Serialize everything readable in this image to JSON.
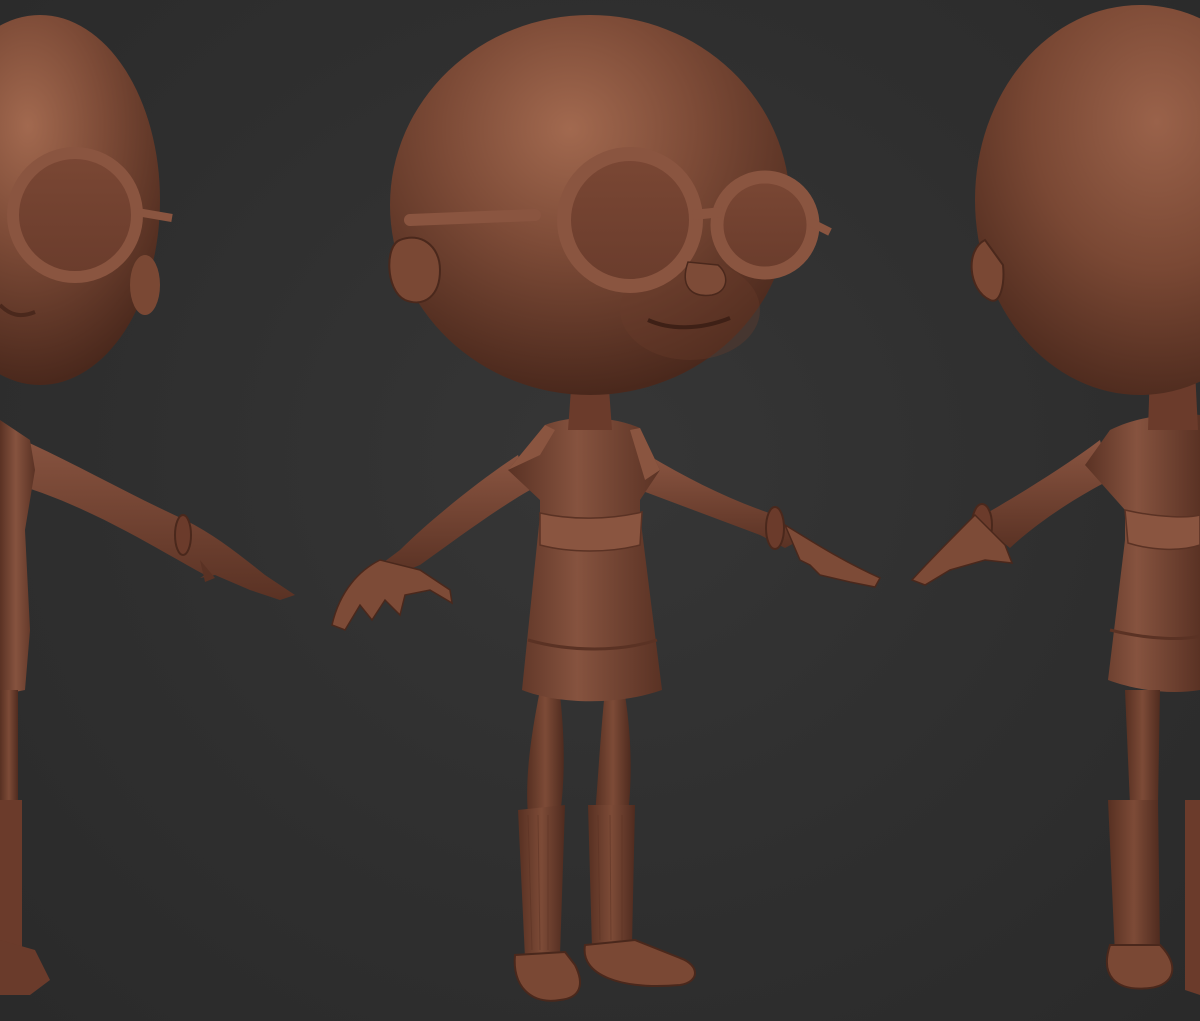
{
  "scene": {
    "background_color": "#2f2f2f",
    "clay_color": "#7a4a38",
    "clay_highlight": "#9a6450",
    "clay_shadow": "#4e2a1e",
    "views": [
      {
        "name": "left-view"
      },
      {
        "name": "front-view"
      },
      {
        "name": "back-view"
      }
    ]
  }
}
